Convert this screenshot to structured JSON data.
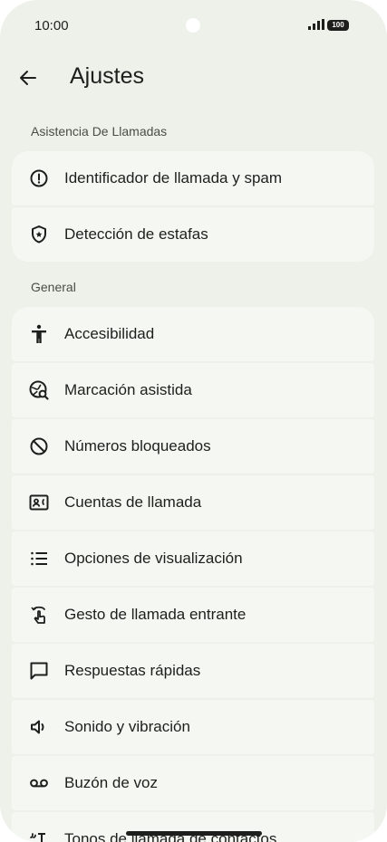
{
  "status_bar": {
    "time": "10:00",
    "battery": "100"
  },
  "header": {
    "title": "Ajustes"
  },
  "sections": [
    {
      "title": "Asistencia De Llamadas",
      "items": [
        {
          "label": "Identificador de llamada y spam",
          "icon": "alert-circle-icon"
        },
        {
          "label": "Detección de estafas",
          "icon": "shield-icon"
        }
      ]
    },
    {
      "title": "General",
      "items": [
        {
          "label": "Accesibilidad",
          "icon": "accessibility-icon"
        },
        {
          "label": "Marcación asistida",
          "icon": "globe-search-icon"
        },
        {
          "label": "Números bloqueados",
          "icon": "block-icon"
        },
        {
          "label": "Cuentas de llamada",
          "icon": "account-card-icon"
        },
        {
          "label": "Opciones de visualización",
          "icon": "list-icon"
        },
        {
          "label": "Gesto de llamada entrante",
          "icon": "gesture-icon"
        },
        {
          "label": "Respuestas rápidas",
          "icon": "message-icon"
        },
        {
          "label": "Sonido y vibración",
          "icon": "volume-icon"
        },
        {
          "label": "Buzón de voz",
          "icon": "voicemail-icon"
        },
        {
          "label": "Tonos de llamada de contactos",
          "icon": "ringtone-icon"
        }
      ]
    }
  ],
  "colors": {
    "background": "#eef0ea",
    "card": "#f5f8f2",
    "text": "#1e1f1c",
    "section_text": "#4a4d47"
  }
}
